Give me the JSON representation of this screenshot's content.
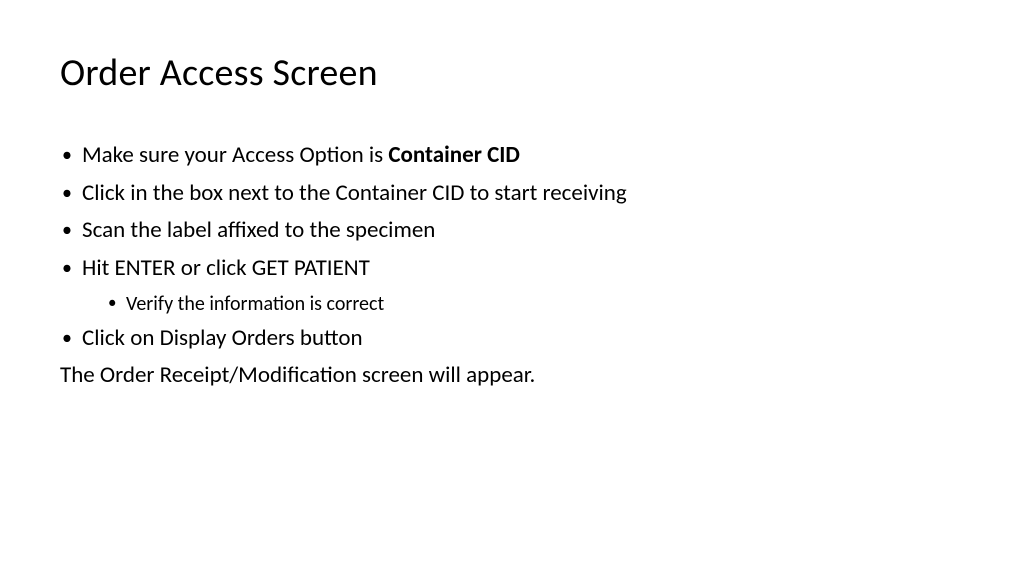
{
  "title": "Order Access Screen",
  "bullets": {
    "b1_prefix": "Make sure your Access Option is ",
    "b1_bold": "Container CID",
    "b2": "Click in the box next to the Container CID to start receiving",
    "b3": "Scan the label affixed to the specimen",
    "b4": "Hit ENTER or click GET PATIENT",
    "b4_sub1": "Verify the information is correct",
    "b5": "Click on Display Orders button"
  },
  "closing": "The Order Receipt/Modification screen will appear."
}
